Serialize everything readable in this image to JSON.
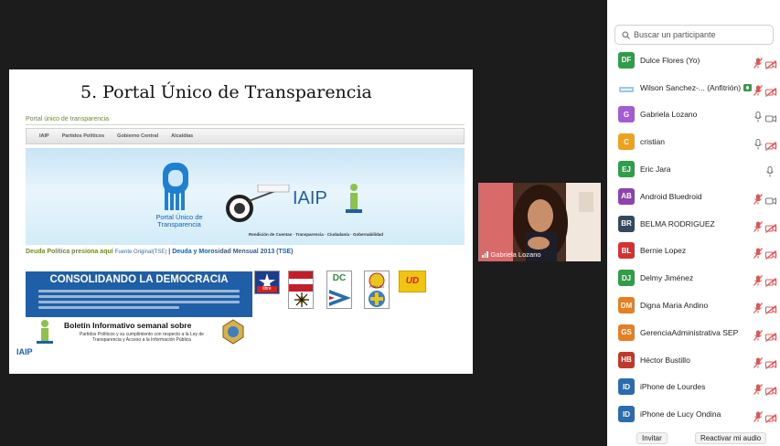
{
  "slide": {
    "title": "5. Portal Único de Transparencia",
    "portal_label": "Portal único de transparencia",
    "nav": [
      "IAIP",
      "Partidos Políticos",
      "Gobierno Central",
      "Alcaldías"
    ],
    "banner_logo_text": "Portal Único de Transparencia",
    "banner_iaip": "IAIP",
    "banner_footer": "Rendición de Cuentas · Transparencia · Ciudadanía · Gobernabilidad",
    "deuda_left": "Deuda Política presiona aquí",
    "deuda_fuente": "Fuente Original(TSE)",
    "deuda_right": "| Deuda y Morosidad Mensual 2013 (TSE)",
    "consolidando": "CONSOLIDANDO LA DEMOCRACIA",
    "boletin_title": "Boletín Informativo semanal sobre",
    "boletin_sub": "Partidos Políticos y su cumplimiento con respecto a la Ley de Transparencia y Acceso a la Información Pública",
    "footer_iaip": "IAIP",
    "parties": [
      {
        "label": "libre",
        "color": "#d32020"
      },
      {
        "label": "",
        "color": "#c41e2a"
      },
      {
        "label": "DC",
        "color": "#2e8b3d"
      },
      {
        "label": "PINU-SD",
        "color": "#e8c61e"
      },
      {
        "label": "UD",
        "color": "#f1c40f"
      }
    ]
  },
  "video": {
    "speaker_name": "Gabriela Lozano"
  },
  "panel": {
    "search_placeholder": "Buscar un participante",
    "participants": [
      {
        "initials": "DF",
        "name": "Dulce Flores (Yo)",
        "color": "#2e9e48",
        "mic": "muted",
        "cam": "off"
      },
      {
        "initials": "",
        "name": "Wilson Sanchez-... (Anfitrión)",
        "color": "#9fc7e6",
        "mic": "muted",
        "cam": "off",
        "host": true
      },
      {
        "initials": "G",
        "name": "Gabriela Lozano",
        "color": "#a35cd1",
        "mic": "on",
        "cam": "on"
      },
      {
        "initials": "C",
        "name": "cristian",
        "color": "#f0a020",
        "mic": "on",
        "cam": "off"
      },
      {
        "initials": "EJ",
        "name": "Eric Jara",
        "color": "#2e9e48",
        "mic": "on",
        "cam": "none"
      },
      {
        "initials": "AB",
        "name": "Android Bluedroid",
        "color": "#8e44ad",
        "mic": "muted",
        "cam": "on"
      },
      {
        "initials": "BR",
        "name": "BELMA RODRIGUEZ",
        "color": "#34495e",
        "mic": "muted",
        "cam": "off"
      },
      {
        "initials": "BL",
        "name": "Bernie Lopez",
        "color": "#d63031",
        "mic": "muted",
        "cam": "off"
      },
      {
        "initials": "DJ",
        "name": "Delmy Jiménez",
        "color": "#2e9e48",
        "mic": "muted",
        "cam": "off"
      },
      {
        "initials": "DM",
        "name": "Digna Maria Andino",
        "color": "#e67e22",
        "mic": "muted",
        "cam": "off"
      },
      {
        "initials": "GS",
        "name": "GerenciaAdministrativa SEP",
        "color": "#e67e22",
        "mic": "muted",
        "cam": "off"
      },
      {
        "initials": "HB",
        "name": "Héctor Bustillo",
        "color": "#c0392b",
        "mic": "muted",
        "cam": "off"
      },
      {
        "initials": "ID",
        "name": "iPhone de Lourdes",
        "color": "#2b6cb0",
        "mic": "muted",
        "cam": "off"
      },
      {
        "initials": "ID",
        "name": "iPhone de Lucy Ondina",
        "color": "#2b6cb0",
        "mic": "muted",
        "cam": "off"
      }
    ],
    "invite_label": "Invitar",
    "unmute_label": "Reactivar mi audio"
  }
}
